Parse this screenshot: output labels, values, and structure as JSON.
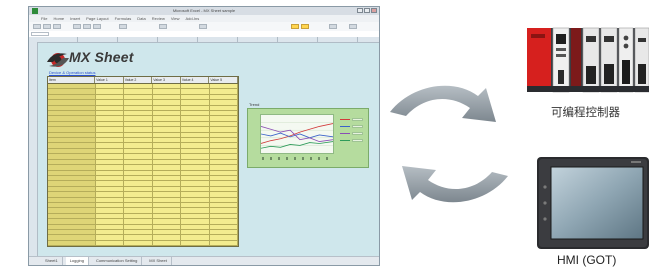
{
  "excel": {
    "window_title": "Microsoft Excel - MX Sheet sample",
    "ribbon_tabs": [
      "File",
      "Home",
      "Insert",
      "Page Layout",
      "Formulas",
      "Data",
      "Review",
      "View",
      "Add-Ins"
    ],
    "app_title": "MX Sheet",
    "table_link": "Device & Operation status",
    "table_headers": [
      "Item",
      "Value 1",
      "Value 2",
      "Value 3",
      "Value 4",
      "Value 5"
    ],
    "trend_label": "Trend",
    "sheet_tabs": [
      "Sheet1",
      "Logging",
      "Communication Setting",
      "MX Sheet"
    ]
  },
  "devices": {
    "plc_label": "可编程控制器",
    "hmi_label": "HMI (GOT)"
  },
  "colors": {
    "sheet_background": "#cfe7ec",
    "table_cell": "#f3ec8f",
    "trend_panel": "#b5dc9e",
    "arrow": "#8f9aa2",
    "plc_accent": "#d6201e",
    "hmi_screen": "#8fa6b3"
  },
  "icons": {
    "arrows": "bidirectional-cycle-arrows-icon",
    "logo": "mx-sheet-logo-icon"
  }
}
